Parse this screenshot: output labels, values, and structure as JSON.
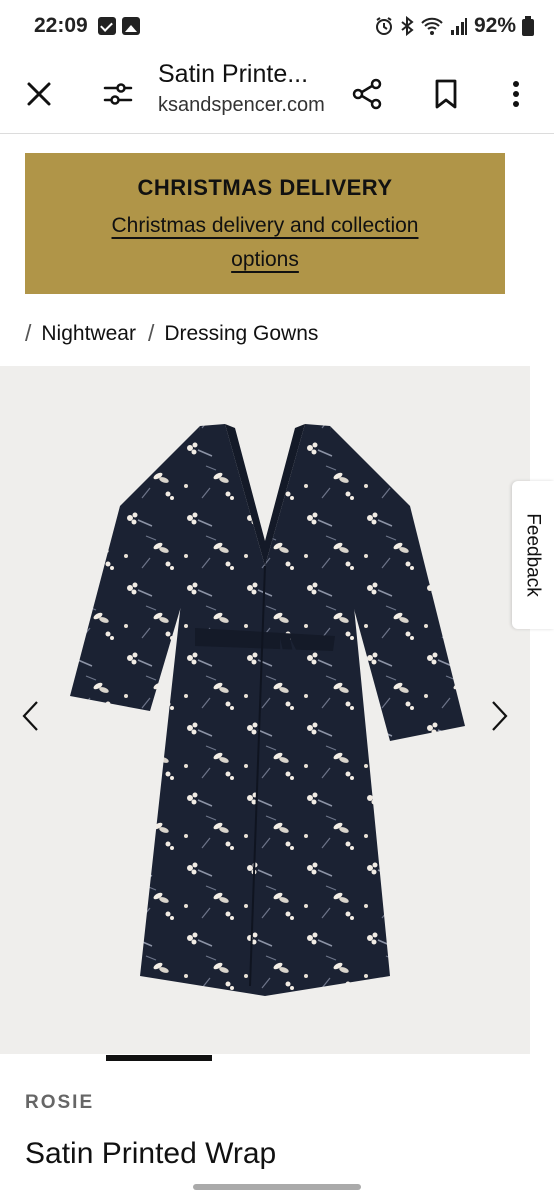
{
  "status_bar": {
    "time": "22:09",
    "battery": "92%",
    "icons": [
      "check-icon",
      "image-icon",
      "alarm-icon",
      "bluetooth-icon",
      "wifi-icon",
      "signal-icon",
      "battery-icon"
    ]
  },
  "toolbar": {
    "title": "Satin Printe...",
    "url": "ksandspencer.com",
    "icons": [
      "close-icon",
      "tune-icon",
      "share-icon",
      "bookmark-icon",
      "more-vert-icon"
    ]
  },
  "banner": {
    "title": "CHRISTMAS DELIVERY",
    "link": "Christmas delivery and collection options",
    "bg_color": "#b09548"
  },
  "breadcrumb": {
    "separator": "/",
    "items": [
      "Nightwear",
      "Dressing Gowns"
    ]
  },
  "gallery": {
    "feedback_label": "Feedback",
    "bg_color": "#efeeec"
  },
  "product": {
    "brand": "ROSIE",
    "name": "Satin Printed Wrap"
  }
}
